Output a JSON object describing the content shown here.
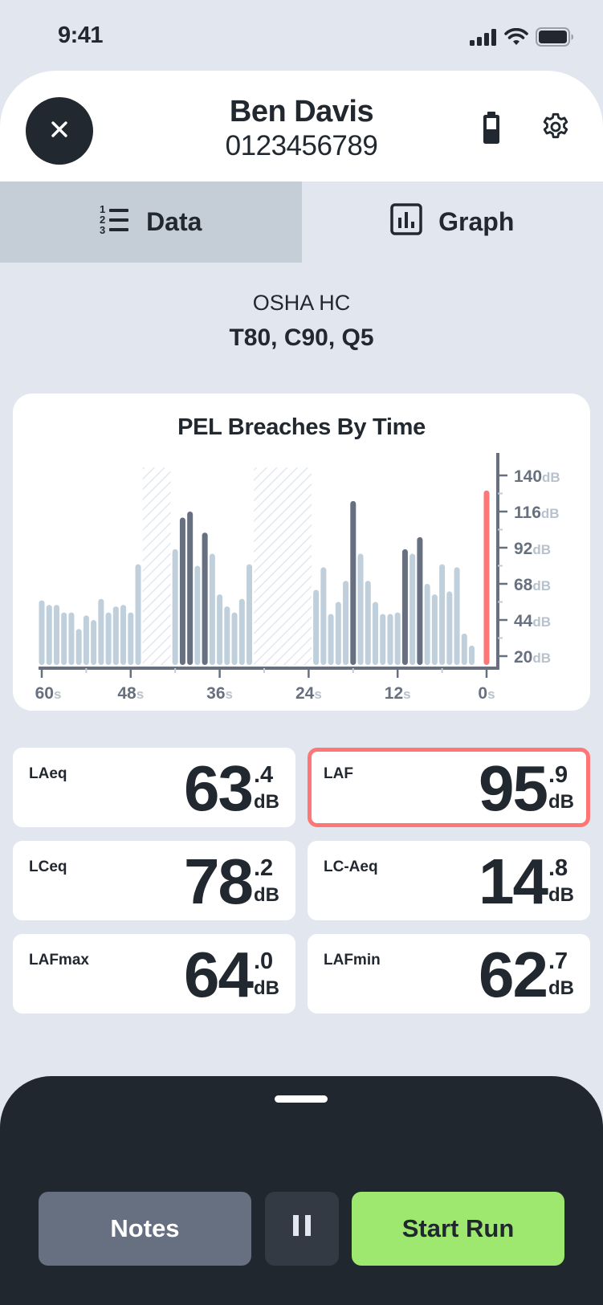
{
  "status_bar": {
    "time": "9:41",
    "icons": [
      "cellular-signal-icon",
      "wifi-icon",
      "battery-icon"
    ]
  },
  "header": {
    "close_icon": "close-icon",
    "name": "Ben Davis",
    "id_number": "0123456789",
    "device_battery_icon": "device-battery-icon",
    "settings_icon": "gear-icon"
  },
  "tabs": [
    {
      "label": "Data",
      "icon": "numbered-list-icon",
      "active": true
    },
    {
      "label": "Graph",
      "icon": "bar-chart-icon",
      "active": false
    }
  ],
  "protocol": {
    "name": "OSHA HC",
    "params": "T80, C90, Q5"
  },
  "chart_data": {
    "type": "bar",
    "title": "PEL Breaches By Time",
    "xlabel": "",
    "ylabel": "",
    "x_unit": "s",
    "y_unit": "dB",
    "x_ticks": [
      60,
      48,
      36,
      24,
      12,
      0
    ],
    "y_ticks": [
      140,
      116,
      92,
      68,
      44,
      20
    ],
    "xlim": [
      60,
      0
    ],
    "ylim": [
      20,
      140
    ],
    "grid": false,
    "legend": "none",
    "colors": {
      "normal": "#bfcfdb",
      "breach": "#667080",
      "current": "#ff7676",
      "gap_hatch": "#e2e8ef",
      "axis": "#67707f"
    },
    "gaps": [
      {
        "from_s": 46,
        "to_s": 43
      },
      {
        "from_s": 31,
        "to_s": 24
      }
    ],
    "bars": [
      {
        "t": 60,
        "value": 57,
        "status": "normal"
      },
      {
        "t": 59,
        "value": 54,
        "status": "normal"
      },
      {
        "t": 58,
        "value": 54,
        "status": "normal"
      },
      {
        "t": 57,
        "value": 49,
        "status": "normal"
      },
      {
        "t": 56,
        "value": 49,
        "status": "normal"
      },
      {
        "t": 55,
        "value": 38,
        "status": "normal"
      },
      {
        "t": 54,
        "value": 47,
        "status": "normal"
      },
      {
        "t": 53,
        "value": 44,
        "status": "normal"
      },
      {
        "t": 52,
        "value": 58,
        "status": "normal"
      },
      {
        "t": 51,
        "value": 49,
        "status": "normal"
      },
      {
        "t": 50,
        "value": 53,
        "status": "normal"
      },
      {
        "t": 49,
        "value": 54,
        "status": "normal"
      },
      {
        "t": 48,
        "value": 49,
        "status": "normal"
      },
      {
        "t": 47,
        "value": 81,
        "status": "normal"
      },
      {
        "t": 42,
        "value": 91,
        "status": "normal"
      },
      {
        "t": 41,
        "value": 112,
        "status": "breach"
      },
      {
        "t": 40,
        "value": 116,
        "status": "breach"
      },
      {
        "t": 39,
        "value": 80,
        "status": "normal"
      },
      {
        "t": 38,
        "value": 102,
        "status": "breach"
      },
      {
        "t": 37,
        "value": 88,
        "status": "normal"
      },
      {
        "t": 36,
        "value": 61,
        "status": "normal"
      },
      {
        "t": 35,
        "value": 53,
        "status": "normal"
      },
      {
        "t": 34,
        "value": 49,
        "status": "normal"
      },
      {
        "t": 33,
        "value": 58,
        "status": "normal"
      },
      {
        "t": 32,
        "value": 81,
        "status": "normal"
      },
      {
        "t": 23,
        "value": 64,
        "status": "normal"
      },
      {
        "t": 22,
        "value": 79,
        "status": "normal"
      },
      {
        "t": 21,
        "value": 48,
        "status": "normal"
      },
      {
        "t": 20,
        "value": 56,
        "status": "normal"
      },
      {
        "t": 19,
        "value": 70,
        "status": "normal"
      },
      {
        "t": 18,
        "value": 123,
        "status": "breach"
      },
      {
        "t": 17,
        "value": 88,
        "status": "normal"
      },
      {
        "t": 16,
        "value": 70,
        "status": "normal"
      },
      {
        "t": 15,
        "value": 56,
        "status": "normal"
      },
      {
        "t": 14,
        "value": 48,
        "status": "normal"
      },
      {
        "t": 13,
        "value": 48,
        "status": "normal"
      },
      {
        "t": 12,
        "value": 49,
        "status": "normal"
      },
      {
        "t": 11,
        "value": 91,
        "status": "breach"
      },
      {
        "t": 10,
        "value": 88,
        "status": "normal"
      },
      {
        "t": 9,
        "value": 99,
        "status": "breach"
      },
      {
        "t": 8,
        "value": 68,
        "status": "normal"
      },
      {
        "t": 7,
        "value": 61,
        "status": "normal"
      },
      {
        "t": 6,
        "value": 81,
        "status": "normal"
      },
      {
        "t": 5,
        "value": 63,
        "status": "normal"
      },
      {
        "t": 4,
        "value": 79,
        "status": "normal"
      },
      {
        "t": 3,
        "value": 35,
        "status": "normal"
      },
      {
        "t": 2,
        "value": 27,
        "status": "normal"
      },
      {
        "t": 0,
        "value": 130,
        "status": "current"
      }
    ]
  },
  "metrics": [
    {
      "label": "LAeq",
      "int": "63",
      "dec": ".4",
      "unit": "dB",
      "alert": false
    },
    {
      "label": "LAF",
      "int": "95",
      "dec": ".9",
      "unit": "dB",
      "alert": true
    },
    {
      "label": "LCeq",
      "int": "78",
      "dec": ".2",
      "unit": "dB",
      "alert": false
    },
    {
      "label": "LC-Aeq",
      "int": "14",
      "dec": ".8",
      "unit": "dB",
      "alert": false
    },
    {
      "label": "LAFmax",
      "int": "64",
      "dec": ".0",
      "unit": "dB",
      "alert": false
    },
    {
      "label": "LAFmin",
      "int": "62",
      "dec": ".7",
      "unit": "dB",
      "alert": false
    }
  ],
  "bottom_bar": {
    "notes_label": "Notes",
    "pause_icon": "pause-icon",
    "start_label": "Start Run"
  },
  "colors": {
    "background": "#e2e7ef",
    "dark": "#21272e",
    "alert": "#ff7676",
    "start_green": "#9fe870",
    "notes_gray": "#667080"
  }
}
